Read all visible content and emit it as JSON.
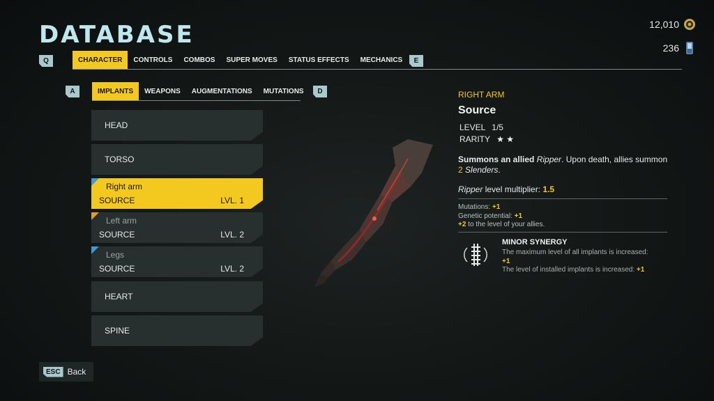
{
  "header": {
    "title": "DATABASE"
  },
  "currency": {
    "coins": "12,010",
    "cells": "236"
  },
  "top_tabs": {
    "left_key": "Q",
    "right_key": "E",
    "items": [
      "CHARACTER",
      "CONTROLS",
      "COMBOS",
      "SUPER MOVES",
      "STATUS EFFECTS",
      "MECHANICS"
    ],
    "active": "CHARACTER"
  },
  "sub_tabs": {
    "left_key": "A",
    "right_key": "D",
    "items": [
      "IMPLANTS",
      "WEAPONS",
      "AUGMENTATIONS",
      "MUTATIONS"
    ],
    "active": "IMPLANTS"
  },
  "implant_list": [
    {
      "label": "HEAD"
    },
    {
      "label": "TORSO"
    },
    {
      "name": "Right arm",
      "sub": "SOURCE",
      "level": "LVL. 1",
      "corner_color": "#3f9ad6"
    },
    {
      "name": "Left arm",
      "sub": "SOURCE",
      "level": "LVL. 2",
      "corner_color": "#e39b2b"
    },
    {
      "name": "Legs",
      "sub": "SOURCE",
      "level": "LVL. 2",
      "corner_color": "#3f9ad6"
    },
    {
      "label": "HEART"
    },
    {
      "label": "SPINE"
    }
  ],
  "detail": {
    "category": "RIGHT ARM",
    "name": "Source",
    "level_label": "LEVEL",
    "level_value": "1/5",
    "rarity_label": "RARITY",
    "rarity_stars": "★ ★",
    "desc_bold": "Summons an allied",
    "desc_ripper": "Ripper",
    "desc_mid": ". Upon death, allies summon",
    "desc_count": "2",
    "desc_slenders": "Slenders",
    "desc_end": ".",
    "mult_ripper": "Ripper",
    "mult_text": " level multiplier: ",
    "mult_value": "1.5",
    "stat1_label": "Mutations: ",
    "stat1_value": "+1",
    "stat2_label": "Genetic potential: ",
    "stat2_value": "+1",
    "stat3_value": "+2",
    "stat3_label": " to the level of your allies.",
    "synergy_title": "MINOR SYNERGY",
    "synergy_line1": "The maximum level of all implants is increased:",
    "synergy_line1_value": "+1",
    "synergy_line2": "The level of installed implants is increased: ",
    "synergy_line2_value": "+1"
  },
  "footer": {
    "key": "ESC",
    "label": "Back"
  },
  "colors": {
    "accent": "#f3c81f",
    "key_bg": "#a9c9cf",
    "panel": "#27302f"
  }
}
